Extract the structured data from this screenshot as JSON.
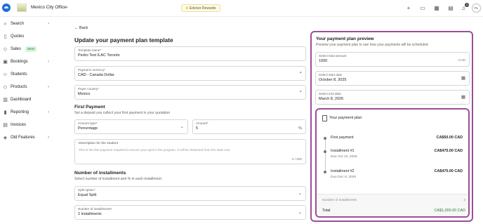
{
  "topbar": {
    "office_name": "Mexico City Office",
    "rewards_label": "Edvisor Rewards",
    "notification_count": "3",
    "avatar_initials": "FL"
  },
  "sidebar": {
    "items": [
      {
        "label": "Search",
        "icon": "search-icon"
      },
      {
        "label": "Quotes",
        "icon": "document-icon"
      },
      {
        "label": "Sales",
        "icon": "tag-icon",
        "badge": "NEW"
      },
      {
        "label": "Bookings",
        "icon": "briefcase-icon"
      },
      {
        "label": "Students",
        "icon": "user-icon"
      },
      {
        "label": "Products",
        "icon": "tag-icon"
      },
      {
        "label": "Dashboard",
        "icon": "chart-icon"
      },
      {
        "label": "Reporting",
        "icon": "bar-chart-icon"
      },
      {
        "label": "Invoices",
        "icon": "receipt-icon"
      },
      {
        "label": "Old Features",
        "icon": "layers-icon"
      }
    ]
  },
  "main": {
    "back_label": "Back",
    "title": "Update your payment plan template",
    "template_name": {
      "label": "Template name*",
      "value": "Pedro Test ILAC Toronto"
    },
    "payment_currency": {
      "label": "Payment currency*",
      "value": "CAD - Canada Dollar"
    },
    "payer_country": {
      "label": "Payer country*",
      "value": "Mexico"
    },
    "first_payment": {
      "title": "First Payment",
      "subtitle": "Set a deposit you collect your first payment in your quotation",
      "amount_type": {
        "label": "Amount type*",
        "value": "Percentage"
      },
      "amount": {
        "label": "Amount*",
        "value": "5",
        "suffix": "%"
      },
      "description": {
        "label": "Description for the student",
        "hint": "This is the first payment required to secure your spot in the program. It will be deducted from the total cost.",
        "count": "0 / 500"
      }
    },
    "installments": {
      "title": "Number of installments",
      "subtitle": "Select number of installment and % in each installment.",
      "split_option": {
        "label": "Split option*",
        "value": "Equal Split"
      },
      "number": {
        "label": "Number of installments*",
        "value": "2 installments"
      }
    }
  },
  "preview": {
    "title": "Your payment plan preview",
    "subtitle": "Preview your payment plan to see how your payments will be scheduled",
    "total_amount": {
      "label": "Select total amount",
      "value": "1000",
      "suffix": "CAD"
    },
    "start_date": {
      "label": "Select start date",
      "value": "October 8, 2025"
    },
    "end_date": {
      "label": "Select end date",
      "value": "March 8, 2026"
    },
    "plan": {
      "title": "Your payment plan",
      "items": [
        {
          "name": "First payment",
          "amount": "CA$50.00 CAD",
          "due": ""
        },
        {
          "name": "Installment #1",
          "amount": "CA$475.00 CAD",
          "due": "Due Oct 10, 2025"
        },
        {
          "name": "Installment #2",
          "amount": "CA$475.00 CAD",
          "due": "Due Dec 8, 2025"
        }
      ],
      "num_installments_label": "Number of installments",
      "num_installments_value": "2",
      "total_label": "Total",
      "total_value": "CA$1,000.00 CAD"
    }
  },
  "colors": {
    "accent": "#9c4d98",
    "brand": "#1f6fd6",
    "total_green": "#2e7d32"
  }
}
